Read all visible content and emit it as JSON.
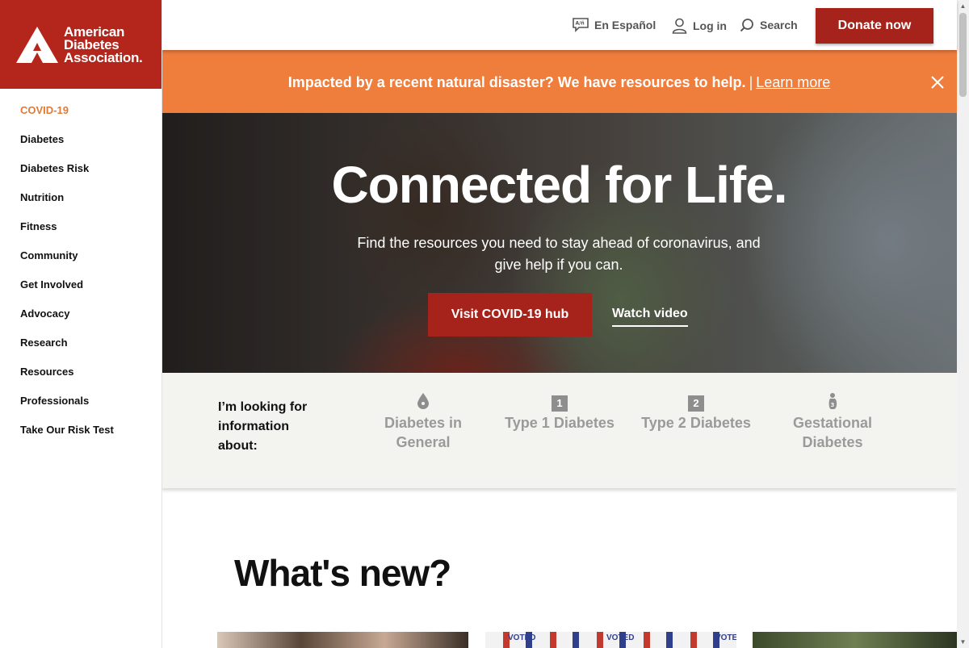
{
  "brand": {
    "name_lines": [
      "American",
      "Diabetes",
      "Association."
    ],
    "color": "#b4261b"
  },
  "sidebar": {
    "items": [
      {
        "label": "COVID-19",
        "active": true
      },
      {
        "label": "Diabetes"
      },
      {
        "label": "Diabetes Risk"
      },
      {
        "label": "Nutrition"
      },
      {
        "label": "Fitness"
      },
      {
        "label": "Community"
      },
      {
        "label": "Get Involved"
      },
      {
        "label": "Advocacy"
      },
      {
        "label": "Research"
      },
      {
        "label": "Resources"
      },
      {
        "label": "Professionals"
      },
      {
        "label": "Take Our Risk Test"
      }
    ]
  },
  "topbar": {
    "language": {
      "label": "En Español",
      "icon": "language-icon"
    },
    "login": {
      "label": "Log in",
      "icon": "user-icon"
    },
    "search": {
      "label": "Search",
      "icon": "search-icon"
    },
    "donate_label": "Donate now"
  },
  "alert": {
    "text": "Impacted by a recent natural disaster? We have resources to help.",
    "separator": "|",
    "link": "Learn more",
    "color": "#ef7d3c"
  },
  "hero": {
    "title": "Connected for Life.",
    "subtitle": "Find the resources you need to stay ahead of coronavirus, and give help if you can.",
    "cta_label": "Visit COVID-19 hub",
    "video_link": "Watch video"
  },
  "info": {
    "label": "I’m looking for information about:",
    "items": [
      {
        "label": "Diabetes in General",
        "icon": "drop-icon"
      },
      {
        "label": "Type 1 Diabetes",
        "icon": "number-1-icon",
        "num": "1"
      },
      {
        "label": "Type 2 Diabetes",
        "icon": "number-2-icon",
        "num": "2"
      },
      {
        "label": "Gestational Diabetes",
        "icon": "gestational-icon"
      }
    ]
  },
  "whats_new": {
    "title": "What's new?",
    "card2_stickers": [
      "VOTED",
      "VOTED",
      "VOTE"
    ]
  },
  "colors": {
    "accent_red": "#a6231b",
    "active_nav": "#e07a38"
  }
}
